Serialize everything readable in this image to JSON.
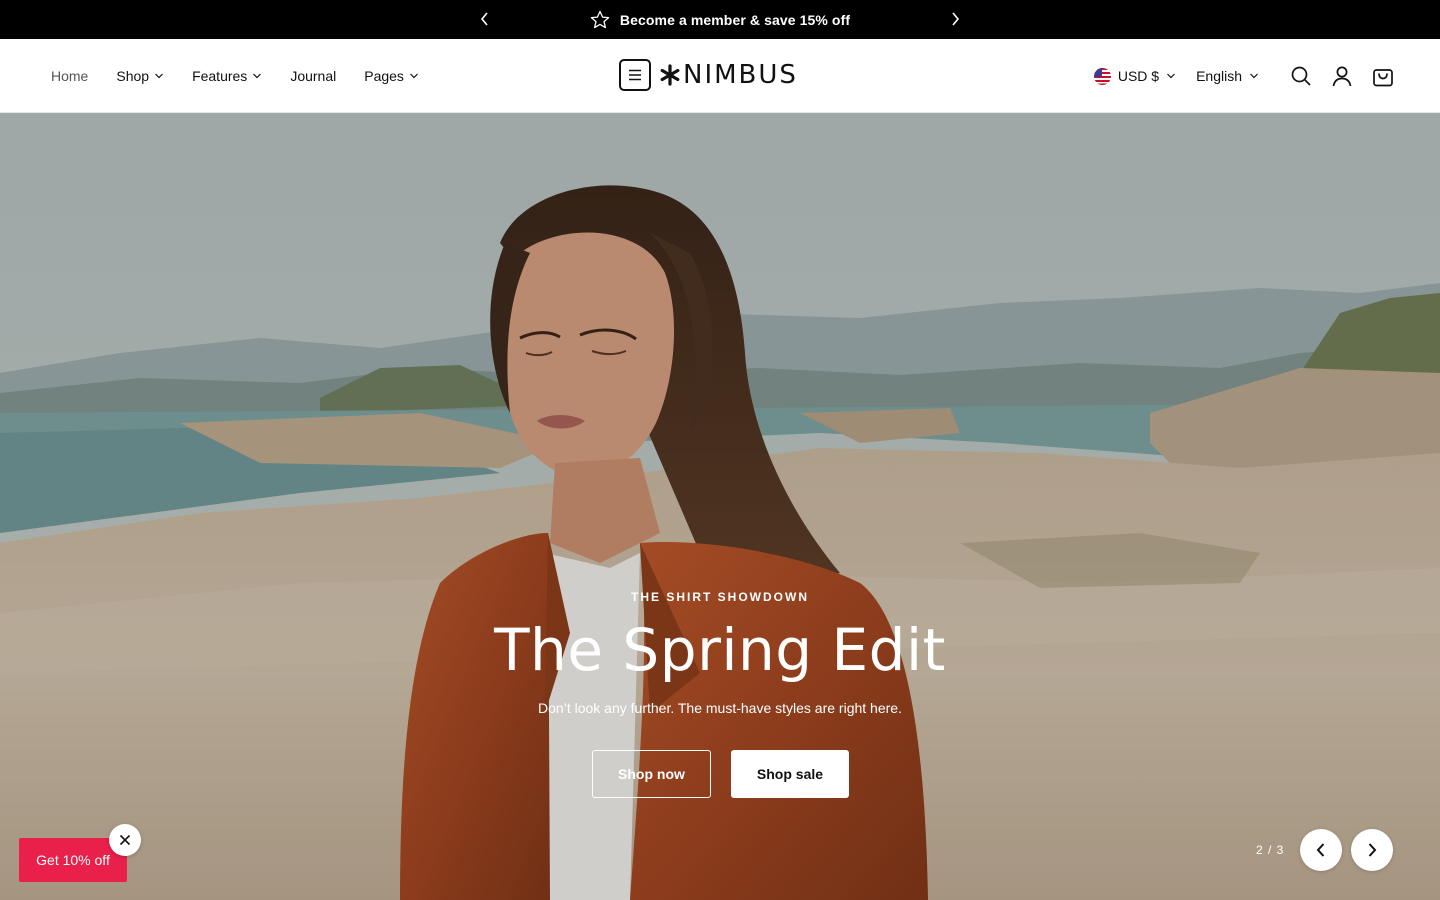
{
  "announcement": {
    "message": "Become a member & save 15% off",
    "icon": "star-icon"
  },
  "nav": {
    "items": [
      {
        "label": "Home",
        "has_dropdown": false,
        "active": true
      },
      {
        "label": "Shop",
        "has_dropdown": true
      },
      {
        "label": "Features",
        "has_dropdown": true
      },
      {
        "label": "Journal",
        "has_dropdown": false
      },
      {
        "label": "Pages",
        "has_dropdown": true
      }
    ]
  },
  "brand": {
    "name": "NIMBUS"
  },
  "header": {
    "currency": "USD $",
    "language": "English"
  },
  "hero": {
    "kicker": "THE SHIRT SHOWDOWN",
    "headline": "The Spring Edit",
    "subtext": "Don’t look any further. The must-have styles are right here.",
    "primary_button": "Shop now",
    "secondary_button": "Shop sale",
    "slide_counter": "2 / 3"
  },
  "popup": {
    "label": "Get 10% off"
  },
  "colors": {
    "announcement_bg": "#000000",
    "discount_bg": "#e8204a",
    "jacket": "#a24a22"
  }
}
